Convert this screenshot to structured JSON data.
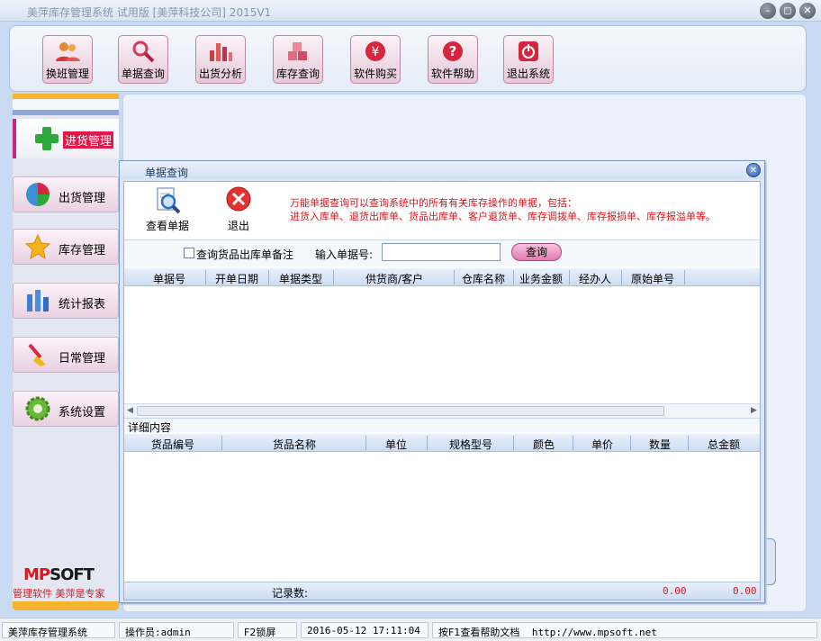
{
  "window": {
    "title": "美萍库存管理系统 试用版 [美萍科技公司] 2015V1",
    "controls": [
      "minimize",
      "restore",
      "close"
    ]
  },
  "toolbar": {
    "items": [
      {
        "label": "换班管理",
        "icon": "users-icon"
      },
      {
        "label": "单据查询",
        "icon": "magnifier-icon"
      },
      {
        "label": "出货分析",
        "icon": "bar-chart-icon"
      },
      {
        "label": "库存查询",
        "icon": "boxes-icon"
      },
      {
        "label": "软件购买",
        "icon": "yen-icon"
      },
      {
        "label": "软件帮助",
        "icon": "help-icon"
      },
      {
        "label": "退出系统",
        "icon": "power-icon"
      }
    ]
  },
  "sidebar": {
    "active": {
      "label": "进货管理",
      "icon": "plus-icon"
    },
    "items": [
      {
        "label": "出货管理",
        "icon": "pie-chart-icon"
      },
      {
        "label": "库存管理",
        "icon": "star-icon"
      },
      {
        "label": "统计报表",
        "icon": "columns-icon"
      },
      {
        "label": "日常管理",
        "icon": "broom-icon"
      },
      {
        "label": "系统设置",
        "icon": "gear-icon"
      }
    ],
    "logo_prefix": "MP",
    "logo_suffix": "SOFT",
    "slogan": "管理软件 美萍是专家"
  },
  "dialog": {
    "title": "单据查询",
    "actions": {
      "view": "查看单据",
      "exit": "退出"
    },
    "notice_line1": "万能单据查询可以查询系统中的所有有关库存操作的单据，包括：",
    "notice_line2": "进货入库单、退货出库单、货品出库单、客户退货单、库存调拨单、库存报损单、库存报溢单等。",
    "search": {
      "checkbox_label": "查询货品出库单备注",
      "checked": false,
      "input_label": "输入单据号:",
      "input_value": "",
      "query_button": "查询"
    },
    "master_columns": [
      "单据号",
      "开单日期",
      "单据类型",
      "供货商/客户",
      "仓库名称",
      "业务金额",
      "经办人",
      "原始单号"
    ],
    "detail_title": "详细内容",
    "detail_columns": [
      "货品编号",
      "货品名称",
      "单位",
      "规格型号",
      "颜色",
      "单价",
      "数量",
      "总金额"
    ],
    "footer": {
      "record_label": "记录数:",
      "qty_total": "0.00",
      "amount_total": "0.00"
    }
  },
  "statusbar": {
    "app": "美萍库存管理系统",
    "operator": "操作员:admin",
    "lock": "F2锁屏",
    "datetime": "2016-05-12 17:11:04",
    "help": "按F1查看帮助文档",
    "url": "http://www.mpsoft.net"
  },
  "colors": {
    "accent_red": "#e2121a",
    "panel_blue": "#dbe6f6",
    "pink_button": "#e6c8d9"
  }
}
